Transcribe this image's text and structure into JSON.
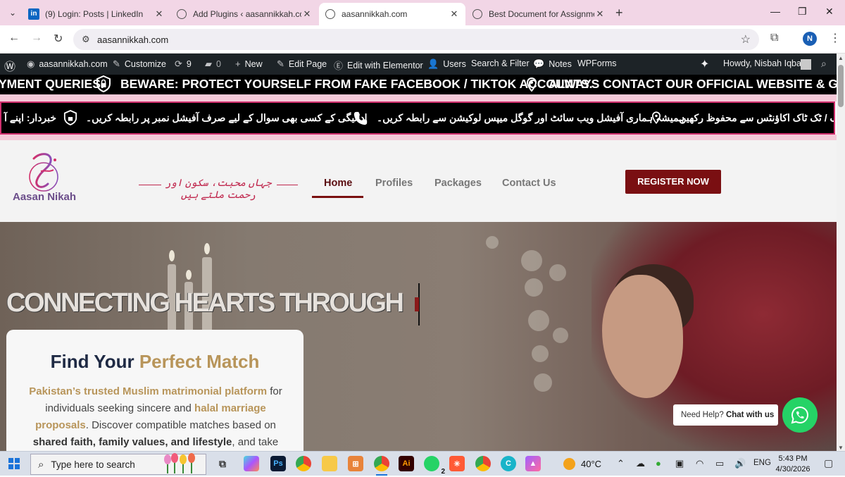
{
  "browser": {
    "tabs": [
      {
        "title": "(9) Login: Posts | LinkedIn",
        "icon": "linkedin-icon"
      },
      {
        "title": "Add Plugins ‹ aasannikkah.com",
        "icon": "globe-icon"
      },
      {
        "title": "aasannikkah.com",
        "icon": "globe-icon",
        "active": true
      },
      {
        "title": "Best Document for Assignment",
        "icon": "app-icon"
      }
    ],
    "url": "aasannikkah.com",
    "profile_initial": "N"
  },
  "wp_admin_bar": {
    "site": "aasannikkah.com",
    "customize": "Customize",
    "updates": "9",
    "comments": "0",
    "new": "New",
    "edit_page": "Edit Page",
    "elementor": "Edit with Elementor",
    "users": "Users",
    "search_filter": "Search & Filter",
    "notes": "Notes",
    "wpforms": "WPForms",
    "howdy": "Howdy, Nisbah Iqbal"
  },
  "marquee_en": {
    "seg1": "YMENT QUERIES.",
    "seg2": "BEWARE: PROTECT YOURSELF FROM FAKE FACEBOOK / TIKTOK ACCOUNTS.",
    "seg3": "ALWAYS CONTACT OUR OFFICIAL WEBSITE & GOOGLE"
  },
  "marquee_ur": {
    "seg1": "خبردار: اپنے آ",
    "seg2": "ادائیگی کے کسی بھی سوال کے لیے صرف آفیشل نمبر پر رابطہ کریں۔",
    "seg3": "ہمیشہ ہماری آفیشل ویب سائٹ اور گوگل میپس لوکیشن سے رابطہ کریں۔",
    "seg4": "بک / ٹک ٹاک اکاؤنٹس سے محفوظ رکھیں۔"
  },
  "header": {
    "logo_text": "Aasan Nikah",
    "tagline": "جہاں محبت، سکون اور رحمت ملتے ہیں",
    "nav": [
      "Home",
      "Profiles",
      "Packages",
      "Contact Us"
    ],
    "cta": "REGISTER NOW"
  },
  "hero": {
    "title": "CONNECTING HEARTS THROUGH",
    "card_title_1": "Find Your",
    "card_title_2": "Perfect Match",
    "desc_1": "Pakistan’s trusted Muslim matrimonial platform",
    "desc_2": " for individuals seeking sincere and ",
    "desc_3": "halal marriage proposals",
    "desc_4": ". Discover compatible matches based on ",
    "desc_5": "shared faith, family values, and lifestyle",
    "desc_6": ", and take"
  },
  "chat": {
    "prefix": "Need Help?",
    "action": "Chat with us"
  },
  "taskbar": {
    "search_placeholder": "Type here to search",
    "temperature": "40°C",
    "lang": "ENG",
    "time": "5:43 PM",
    "date": "4/30/2026",
    "whatsapp_badge": "2"
  },
  "colors": {
    "maroon": "#7a0f12",
    "gold": "#b8955a",
    "navy": "#1f2a44",
    "admin_bar": "#1d2327",
    "marquee_border": "#d12f6e"
  }
}
